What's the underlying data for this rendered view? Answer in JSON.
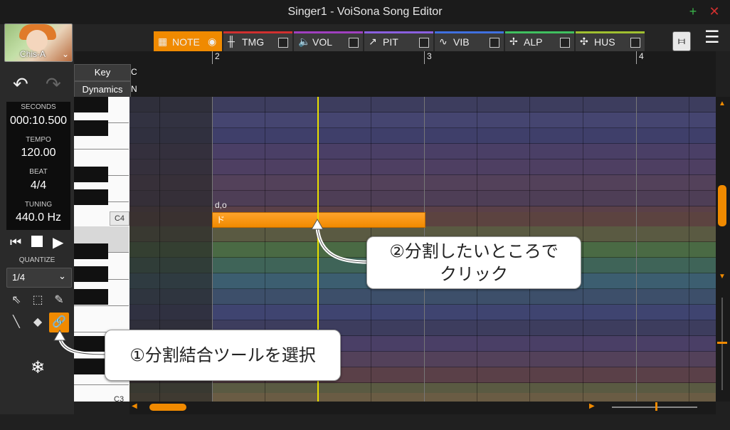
{
  "window": {
    "title": "Singer1 - VoiSona Song Editor"
  },
  "singer": {
    "name": "Chis-A"
  },
  "history": {
    "undo_icon": "undo-icon",
    "redo_icon": "redo-icon"
  },
  "info": {
    "seconds_label": "SECONDS",
    "seconds_value": "000:10.500",
    "tempo_label": "TEMPO",
    "tempo_value": "120.00",
    "beat_label": "BEAT",
    "beat_value": "4/4",
    "tuning_label": "TUNING",
    "tuning_value": "440.0 Hz"
  },
  "quantize": {
    "label": "QUANTIZE",
    "value": "1/4"
  },
  "tabs": [
    {
      "label": "NOTE",
      "color": "#f08a00",
      "active": true
    },
    {
      "label": "TMG",
      "color": "#d0302f"
    },
    {
      "label": "VOL",
      "color": "#a040c0"
    },
    {
      "label": "PIT",
      "color": "#8a60e0"
    },
    {
      "label": "VIB",
      "color": "#4070e0"
    },
    {
      "label": "ALP",
      "color": "#40c060"
    },
    {
      "label": "HUS",
      "color": "#a0c030"
    }
  ],
  "ruler": {
    "bars": [
      "2",
      "3",
      "4"
    ]
  },
  "headers": {
    "key_label": "Key",
    "key_value": "C",
    "dynamics_label": "Dynamics",
    "dynamics_value": "N"
  },
  "piano": {
    "c4_label": "C4",
    "c3_label": "C3"
  },
  "note": {
    "lyric": "ド",
    "phoneme": "d,o"
  },
  "callouts": {
    "step2_line1": "②分割したいところで",
    "step2_line2": "クリック",
    "step1": "①分割結合ツールを選択"
  },
  "colors": {
    "accent": "#f08a00",
    "playhead": "#e8e000"
  }
}
